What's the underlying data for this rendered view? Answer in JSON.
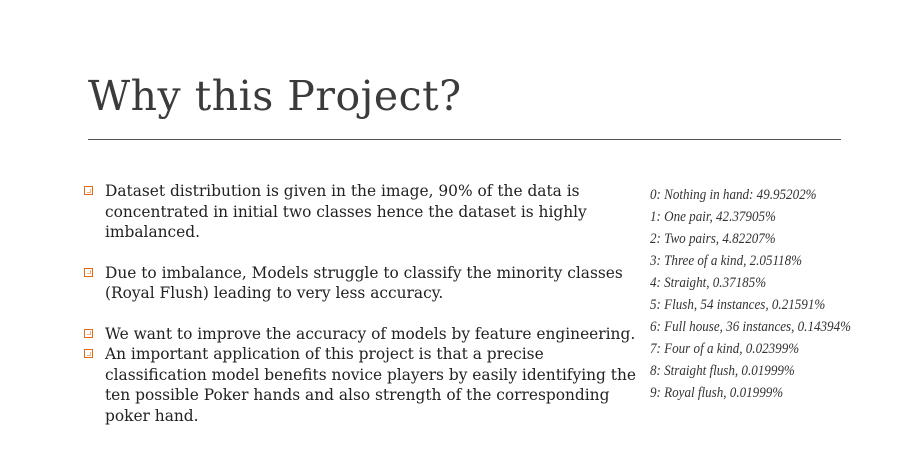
{
  "slide": {
    "title": "Why this Project?",
    "bullets": [
      "Dataset distribution is given in the image, 90% of the data is concentrated in initial two classes hence the dataset is highly imbalanced.",
      "Due to imbalance, Models struggle to classify the minority classes (Royal Flush) leading to very less accuracy.",
      "We want to improve the accuracy of models by feature engineering.",
      "An important application of this project is that a precise classification model benefits novice players by easily identifying the ten possible Poker hands and also strength of the corresponding poker hand."
    ],
    "bullet_marker_color": "#e06a1b",
    "distribution": [
      "0: Nothing in hand: 49.95202%",
      "1: One pair, 42.37905%",
      "2: Two pairs, 4.82207%",
      "3: Three of a kind, 2.05118%",
      "4: Straight, 0.37185%",
      "5: Flush, 54 instances, 0.21591%",
      "6: Full house, 36 instances, 0.14394%",
      "7: Four of a kind, 0.02399%",
      "8: Straight flush, 0.01999%",
      "9: Royal flush, 0.01999%"
    ]
  }
}
